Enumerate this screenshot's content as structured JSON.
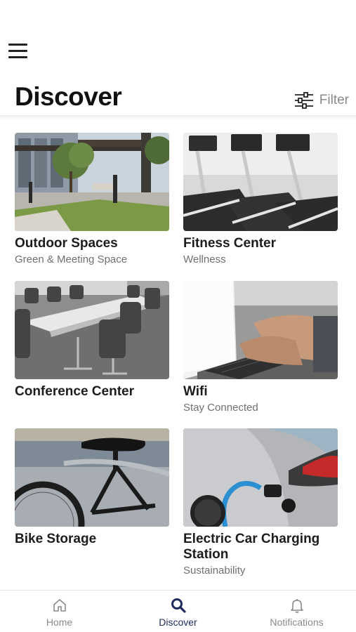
{
  "header": {
    "menu_icon": "hamburger-menu-icon",
    "title": "Discover",
    "filter_label": "Filter",
    "filter_icon": "sliders-icon"
  },
  "cards": [
    {
      "title": "Outdoor Spaces",
      "subtitle": "Green & Meeting Space",
      "image": "outdoor-patio-photo"
    },
    {
      "title": "Fitness Center",
      "subtitle": "Wellness",
      "image": "treadmills-photo"
    },
    {
      "title": "Conference Center",
      "subtitle": "",
      "image": "conference-room-photo"
    },
    {
      "title": "Wifi",
      "subtitle": "Stay Connected",
      "image": "laptop-typing-photo"
    },
    {
      "title": "Bike Storage",
      "subtitle": "",
      "image": "bicycle-photo"
    },
    {
      "title": "Electric Car Charging Station",
      "subtitle": "Sustainability",
      "image": "ev-charging-photo"
    }
  ],
  "tabbar": {
    "tabs": [
      {
        "label": "Home",
        "icon": "home-icon",
        "active": false
      },
      {
        "label": "Discover",
        "icon": "search-icon",
        "active": true
      },
      {
        "label": "Notifications",
        "icon": "bell-icon",
        "active": false
      }
    ]
  },
  "colors": {
    "accent": "#1f2a5c",
    "inactive": "#8a8a8a",
    "text": "#1d1d1d",
    "subtitle": "#707070"
  }
}
